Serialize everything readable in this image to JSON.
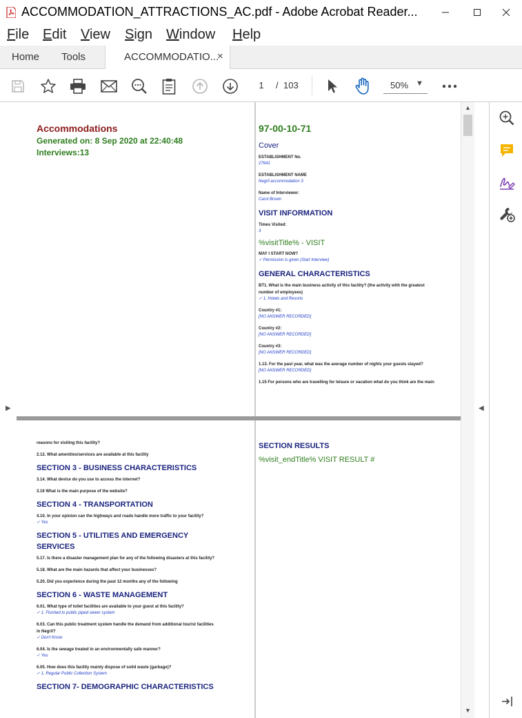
{
  "window": {
    "title": "ACCOMMODATION_ATTRACTIONS_AC.pdf - Adobe Acrobat Reader...",
    "minimize_icon": "minimize-icon",
    "maximize_icon": "maximize-icon",
    "close_icon": "close-icon"
  },
  "menu": {
    "items": [
      {
        "first": "F",
        "rest": "ile"
      },
      {
        "first": "E",
        "rest": "dit"
      },
      {
        "first": "V",
        "rest": "iew"
      },
      {
        "first": "S",
        "rest": "ign"
      },
      {
        "first": "W",
        "rest": "indow"
      },
      {
        "first": "H",
        "rest": "elp"
      }
    ]
  },
  "tabs": {
    "home": "Home",
    "tools": "Tools",
    "document": "ACCOMMODATIO...",
    "close": "×"
  },
  "toolbar": {
    "page_current": "1",
    "page_sep": "/",
    "page_total": "103",
    "zoom": "50%",
    "zoom_arrow": "▼",
    "icons": [
      "save-icon",
      "bookmark-star-icon",
      "print-icon",
      "email-icon",
      "zoom-search-icon",
      "clipboard-icon",
      "page-up-icon",
      "page-down-icon",
      "select-cursor-icon",
      "hand-tool-icon",
      "more-icon"
    ]
  },
  "side_panel": {
    "icons": [
      "zoom-in-icon",
      "comment-icon",
      "fill-sign-icon",
      "tools-icon",
      "collapse-panel-icon"
    ]
  },
  "gutters": {
    "left_arrow": "▶",
    "right_arrow": "◀",
    "scroll_up": "▲",
    "scroll_down": "▼"
  },
  "page1": {
    "title": "Accommodations",
    "generated": "Generated on: 8 Sep 2020 at 22:40:48",
    "interviews": "Interviews:13"
  },
  "page2": {
    "code": "97-00-10-71",
    "cover": "Cover",
    "est_no_q": "ESTABLISHMENT No.",
    "est_no_a": "27641",
    "est_name_q": "ESTABLISHMENT NAME",
    "est_name_a": "Negril accommodation 3",
    "interviewer_q": "Name of Interviewer:",
    "interviewer_a": "Carol Brown",
    "visit_info": "VISIT INFORMATION",
    "times_q": "Times Visited:",
    "times_a": "3",
    "visit_title": "%visitTitle% - VISIT",
    "start_q": "MAY I START NOW?",
    "start_a": "✓ Permission is given (Start Interview)",
    "general": "GENERAL CHARACTERISTICS",
    "bt1_q1": "BT1. What is the main business activity of this facility? (the activity  with the greatest",
    "bt1_q2": "number of employees)",
    "bt1_a": "✓ 1. Hotels and Resorts",
    "c1_q": "Country #1:",
    "c1_a": "[NO ANSWER RECORDED]",
    "c2_q": "Country #2:",
    "c2_a": "[NO ANSWER RECORDED]",
    "c3_q": "Country #3:",
    "c3_a": "[NO ANSWER RECORDED]",
    "q113": "1.13. For the past year, what was the average number of nights your guests stayed?",
    "a113": "[NO ANSWER RECORDED]",
    "q115": "1.15 For persons who are travelling for leisure or vacation what do you think are the main"
  },
  "page3": {
    "cont": "reasons for visiting this facility?",
    "q212": "2.12. What amenities/services are available at this facility",
    "s3": "SECTION 3 - BUSINESS CHARACTERISTICS",
    "q314": "3.14. What device do you use to access the internet?",
    "q316": "3.16 What is the main purpose of the website?",
    "s4": "SECTION 4 - TRANSPORTATION",
    "q410": "4.10. In your opinion can the highways and roads handle more traffic to your facility?",
    "a410": "✓ Yes",
    "s5a": "SECTION 5 - UTILITIES AND EMERGENCY",
    "s5b": "SERVICES",
    "q517": "5.17. Is there a disaster management plan for any of the following disasters at this facility?",
    "q518": "5.18. What are the main hazards that affect your businesses?",
    "q520": "5.20. Did you experience during the past 12 months any of the following",
    "s6": "SECTION 6 - WASTE MANAGEMENT",
    "q601": "6.01. What type of toilet facilities are available to your guest at this facility?",
    "a601": "✓ 1. Flushed to public piped sewer system",
    "q603a": "6.03. Can this public treatment system handle the demand from additional tourist facilities",
    "q603b": "in Negril?",
    "a603": "✓ Don't Know",
    "q604": "6.04. Is the sewage treated in an environmentally safe manner?",
    "a604": "✓ Yes",
    "q605": "6.05. How does this facility mainly dispose of solid waste (garbage)?",
    "a605": "✓ 1. Regular Public Collection System",
    "s7": "SECTION 7- DEMOGRAPHIC CHARACTERISTICS"
  },
  "page4": {
    "results": "SECTION RESULTS",
    "end_title": "%visit_endTitle% VISIT RESULT #"
  }
}
